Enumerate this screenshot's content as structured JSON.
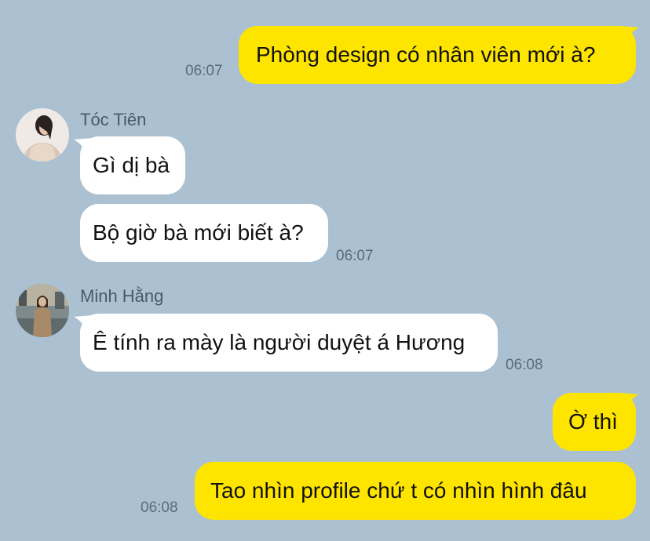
{
  "colors": {
    "background": "#abc1d1",
    "outgoing_bubble": "#fee500",
    "incoming_bubble": "#ffffff"
  },
  "messages": [
    {
      "direction": "outgoing",
      "text": "Phòng design có nhân viên mới à?",
      "time": "06:07"
    },
    {
      "direction": "incoming",
      "sender": "Tóc Tiên",
      "avatar_icon": "woman-portrait-avatar-icon",
      "text": "Gì dị bà"
    },
    {
      "direction": "incoming",
      "text": "Bộ giờ bà mới biết à?",
      "time": "06:07"
    },
    {
      "direction": "incoming",
      "sender": "Minh Hằng",
      "avatar_icon": "woman-trenchcoat-avatar-icon",
      "text": "Ê tính ra mày là người duyệt á Hương",
      "time": "06:08"
    },
    {
      "direction": "outgoing",
      "text": "Ờ thì"
    },
    {
      "direction": "outgoing",
      "text": "Tao nhìn profile chứ t có nhìn hình đâu",
      "time": "06:08"
    }
  ]
}
